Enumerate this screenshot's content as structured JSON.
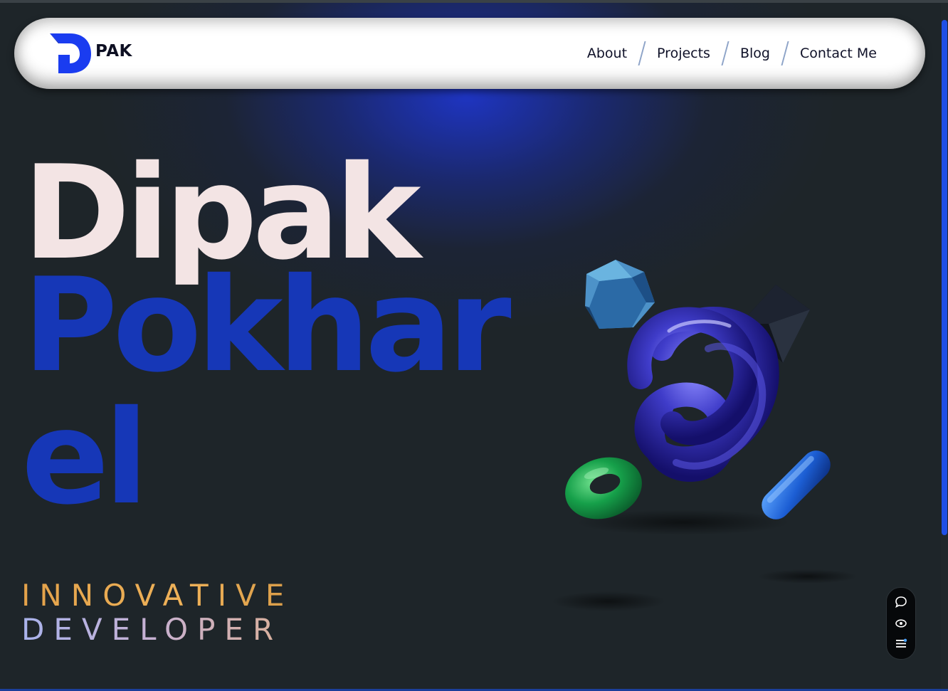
{
  "header": {
    "logo_text": "PAK",
    "nav": [
      {
        "label": "About"
      },
      {
        "label": "Projects"
      },
      {
        "label": "Blog"
      },
      {
        "label": "Contact Me"
      }
    ]
  },
  "hero": {
    "name_first": "Dipak",
    "name_last_line1": "Pokhar",
    "name_last_line2": "el",
    "tagline_line1": "INNOVATIVE",
    "tagline_line2": "DEVELOPER"
  },
  "floating_toolbar": {
    "icons": [
      "chat-icon",
      "eye-icon",
      "list-settings-icon"
    ]
  },
  "colors": {
    "accent_blue": "#1f4fe6",
    "name_last": "#1637b7",
    "name_first": "#f3e4e4",
    "tagline_orange": "#e8a04c",
    "background": "#1e2529"
  }
}
